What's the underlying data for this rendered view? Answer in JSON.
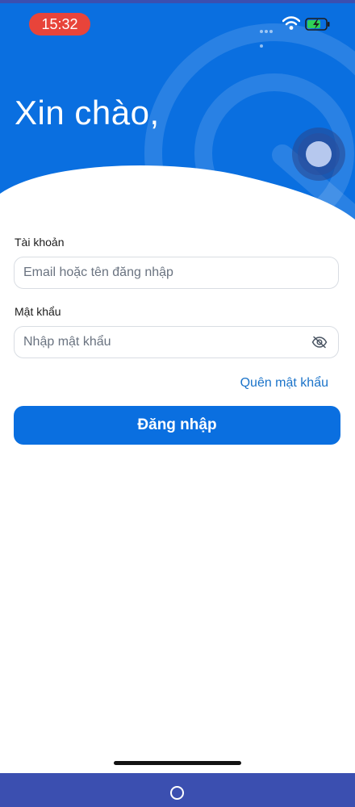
{
  "status_bar": {
    "time": "15:32"
  },
  "header": {
    "greeting": "Xin chào,",
    "brand_color": "#0a6fe0"
  },
  "form": {
    "account_label": "Tài khoản",
    "account_placeholder": "Email hoặc tên đăng nhập",
    "account_value": "",
    "password_label": "Mật khẩu",
    "password_placeholder": "Nhập mật khẩu",
    "password_value": "",
    "forgot_label": "Quên mật khẩu",
    "login_label": "Đăng nhập"
  },
  "icons": {
    "wifi": "wifi-icon",
    "battery": "battery-charging-icon",
    "eye": "eye-off-icon",
    "assist": "assistive-touch-icon",
    "home": "home-circle-icon"
  }
}
